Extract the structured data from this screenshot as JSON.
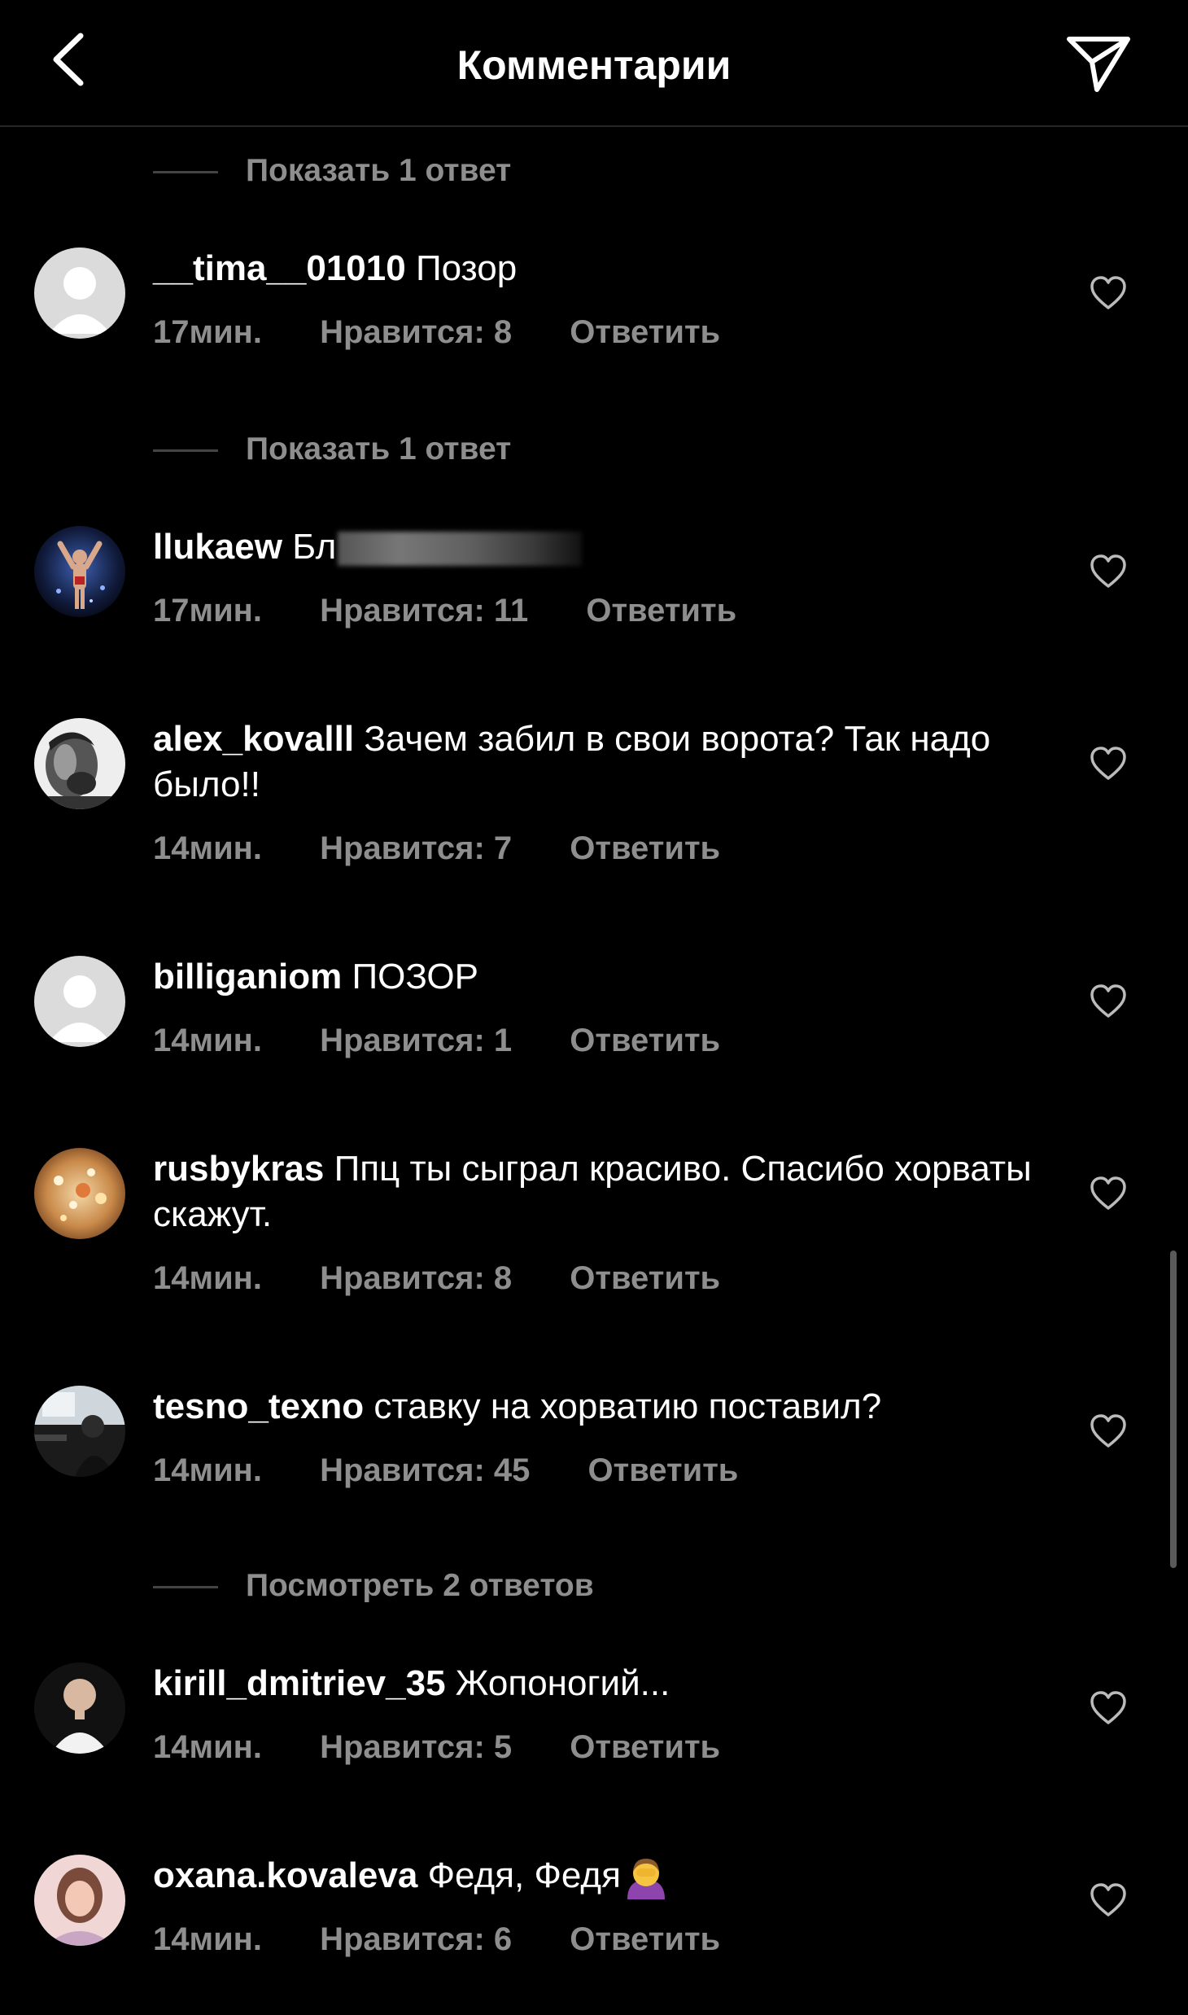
{
  "header": {
    "title": "Комментарии",
    "back_icon": "chevron-left-icon",
    "send_icon": "paper-plane-icon"
  },
  "colors": {
    "background": "#000000",
    "secondary_text": "#8e8e8e",
    "primary_text": "#ffffff"
  },
  "reply_toggles": [
    {
      "label": "Показать 1 ответ"
    },
    {
      "label": "Показать 1 ответ"
    },
    {
      "label": "Посмотреть 2 ответов"
    }
  ],
  "comments": [
    {
      "username": "__tima__01010",
      "text": "Позор",
      "time": "17мин.",
      "likes": "Нравится: 8",
      "reply": "Ответить",
      "avatar": "default-avatar"
    },
    {
      "username": "llukaew",
      "text": "Бл",
      "time": "17мин.",
      "likes": "Нравится: 11",
      "reply": "Ответить",
      "avatar": "boxer-photo"
    },
    {
      "username": "alex_kovalll",
      "text": "Зачем забил в свои ворота? Так надо было!!",
      "time": "14мин.",
      "likes": "Нравится: 7",
      "reply": "Ответить",
      "avatar": "man-photo"
    },
    {
      "username": "billiganiom",
      "text": "ПОЗОР",
      "time": "14мин.",
      "likes": "Нравится: 1",
      "reply": "Ответить",
      "avatar": "default-avatar"
    },
    {
      "username": "rusbykras",
      "text": "Ппц ты сыграл красиво. Спасибо хорваты  скажут.",
      "time": "14мин.",
      "likes": "Нравится: 8",
      "reply": "Ответить",
      "avatar": "lights-photo"
    },
    {
      "username": "tesno_texno",
      "text": "ставку на хорватию поставил?",
      "time": "14мин.",
      "likes": "Нравится: 45",
      "reply": "Ответить",
      "avatar": "car-photo"
    },
    {
      "username": "kirill_dmitriev_35",
      "text": "Жопоногий...",
      "time": "14мин.",
      "likes": "Нравится: 5",
      "reply": "Ответить",
      "avatar": "bald-man-photo"
    },
    {
      "username": "oxana.kovaleva",
      "text": "Федя, Федя",
      "time": "14мин.",
      "likes": "Нравится: 6",
      "reply": "Ответить",
      "avatar": "woman-photo",
      "emoji": "facepalm-emoji"
    }
  ]
}
